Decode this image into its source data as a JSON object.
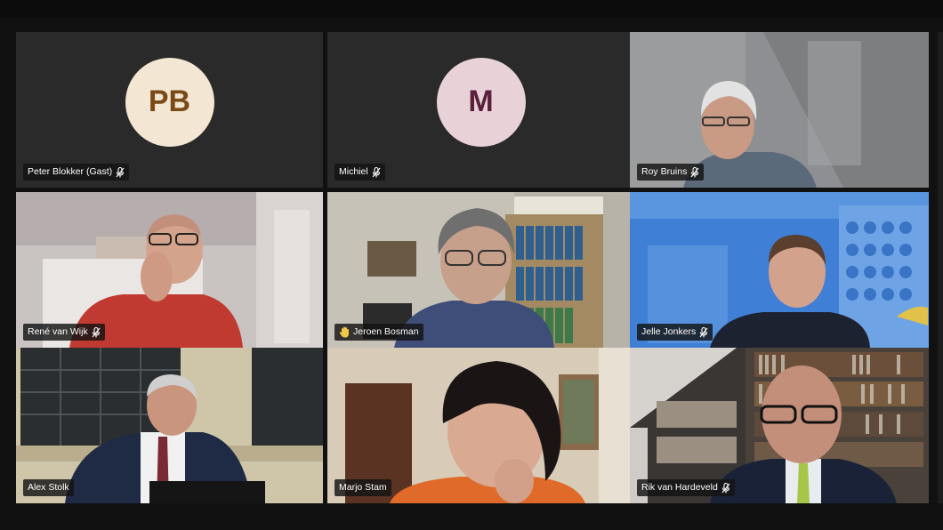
{
  "meeting": {
    "participants": [
      {
        "name": "Peter Blokker (Gast)",
        "initials": "PB",
        "video": false,
        "avatar_bg": "#f3e6d3",
        "avatar_fg": "#7a4a16",
        "muted": true
      },
      {
        "name": "Michiel",
        "initials": "M",
        "video": false,
        "avatar_bg": "#e8d2d8",
        "avatar_fg": "#5a1f3b",
        "muted": true
      },
      {
        "name": "Roy Bruins",
        "video": true,
        "muted": true
      },
      {
        "name": "René van Wijk",
        "video": true,
        "muted": true
      },
      {
        "name": "Jeroen Bosman",
        "video": true,
        "muted": false,
        "hand_raised": true
      },
      {
        "name": "Jelle Jonkers",
        "video": true,
        "muted": true
      },
      {
        "name": "Alex Stolk",
        "video": true,
        "muted": false
      },
      {
        "name": "Marjo Stam",
        "video": true,
        "muted": false
      },
      {
        "name": "Rik van Hardeveld",
        "video": true,
        "muted": true
      }
    ]
  },
  "colors": {
    "background": "#111111",
    "tile_background": "#262626",
    "nameplate": "#141414",
    "text": "#ffffff"
  }
}
